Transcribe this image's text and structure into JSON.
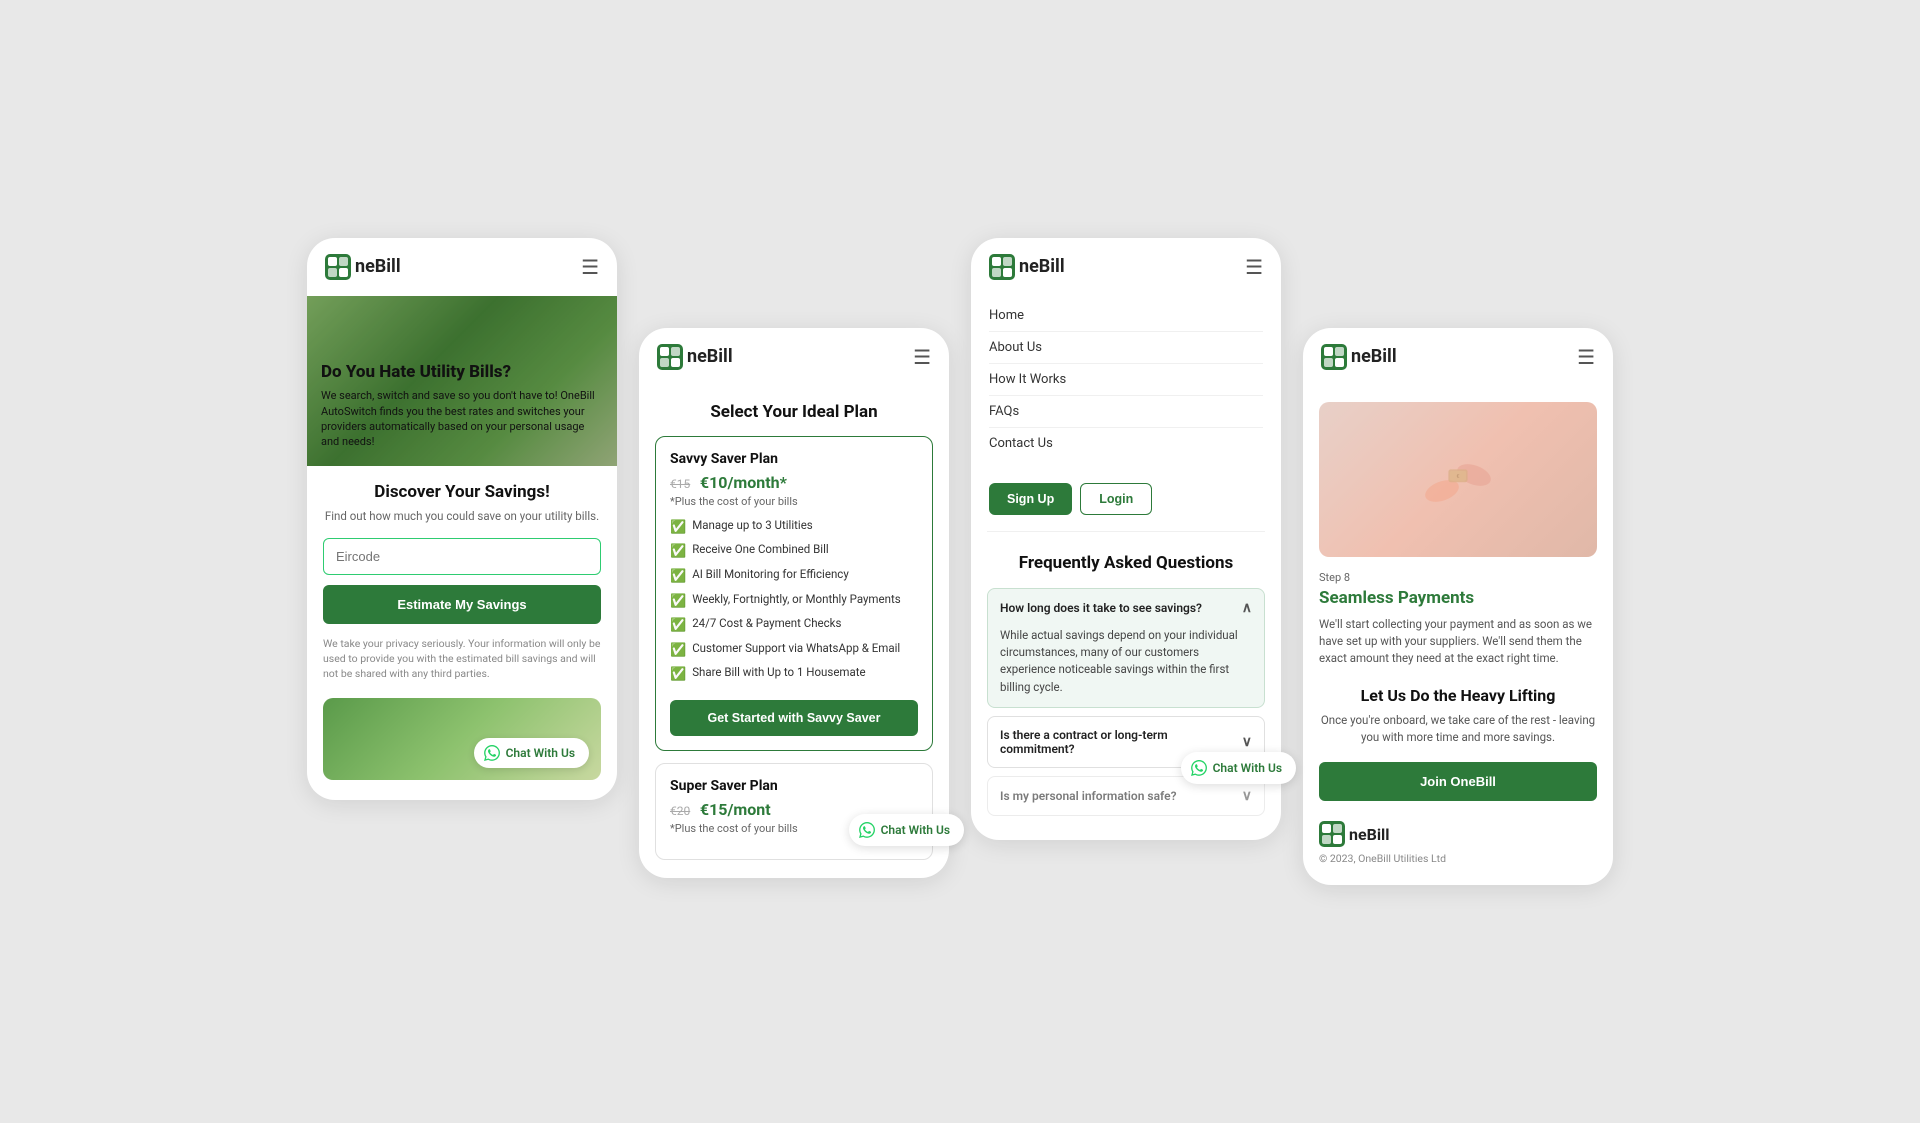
{
  "brand": {
    "name": "neBill",
    "logo_prefix": "O"
  },
  "phone1": {
    "nav": {
      "hamburger": "☰"
    },
    "hero": {
      "title": "Do You Hate Utility Bills?",
      "description": "We search, switch and save so you don't have to! OneBill AutoSwitch finds you the best rates and switches your providers automatically based on your personal usage and needs!"
    },
    "discover": {
      "title": "Discover Your Savings!",
      "subtitle": "Find out how much you could save on your utility bills.",
      "input_placeholder": "Eircode",
      "button_label": "Estimate My Savings",
      "privacy_text": "We take your privacy seriously. Your information will only be used to provide you with the estimated bill savings and will not be shared with any third parties."
    },
    "chat_bubble": "Chat With Us"
  },
  "phone2": {
    "nav": {
      "hamburger": "☰"
    },
    "plans_title": "Select Your Ideal Plan",
    "savvy_plan": {
      "name": "Savvy Saver Plan",
      "price_old": "€15",
      "price_new": "€10/month*",
      "note": "*Plus the cost of your bills",
      "features": [
        "Manage up to 3 Utilities",
        "Receive One Combined Bill",
        "AI Bill Monitoring for Efficiency",
        "Weekly, Fortnightly, or Monthly Payments",
        "24/7 Cost & Payment Checks",
        "Customer Support via WhatsApp & Email",
        "Share Bill with Up to 1 Housemate"
      ],
      "cta": "Get Started with Savvy Saver"
    },
    "super_plan": {
      "name": "Super Saver Plan",
      "price_old": "€20",
      "price_new": "€15/mont",
      "note": "*Plus the cost of your bills"
    },
    "chat_bubble": "Chat With Us"
  },
  "phone3": {
    "nav": {
      "hamburger": "☰"
    },
    "menu_items": [
      "Home",
      "About Us",
      "How It Works",
      "FAQs",
      "Contact Us"
    ],
    "btn_signup": "Sign Up",
    "btn_login": "Login",
    "faq_title": "Frequently Asked Questions",
    "faqs": [
      {
        "question": "How long does it take to see savings?",
        "answer": "While actual savings depend on your individual circumstances, many of our customers experience noticeable savings within the first billing cycle.",
        "open": true
      },
      {
        "question": "Is there a contract or long-term commitment?",
        "answer": "",
        "open": false
      },
      {
        "question": "Is my personal information safe?",
        "answer": "",
        "open": false
      }
    ],
    "chat_bubble": "Chat With Us"
  },
  "phone4": {
    "nav": {
      "hamburger": "☰"
    },
    "step_label": "Step 8",
    "step_title": "Seamless Payments",
    "step_desc": "We'll start collecting your payment and as soon as we have set up with your suppliers. We'll send them the exact amount they need at the exact right time.",
    "heavy_lifting_title": "Let Us Do the Heavy Lifting",
    "heavy_lifting_desc": "Once you're onboard, we take care of the rest - leaving you with more time and more savings.",
    "join_btn": "Join OneBill",
    "footer_copy": "© 2023, OneBill Utilities Ltd"
  }
}
